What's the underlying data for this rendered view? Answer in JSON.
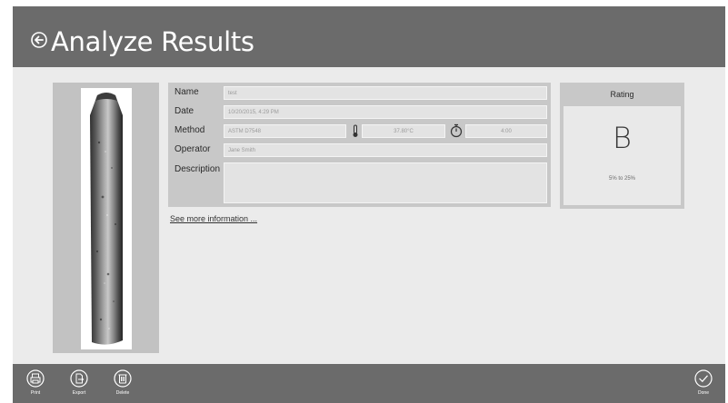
{
  "header": {
    "title": "Analyze Results",
    "back_icon": "back-arrow-circle-icon"
  },
  "image": {
    "alt": "Test specimen"
  },
  "details": {
    "name_label": "Name",
    "name_value": "test",
    "date_label": "Date",
    "date_value": "10/20/2015, 4:29 PM",
    "method_label": "Method",
    "method_value": "ASTM D7548",
    "temperature_icon": "thermometer-icon",
    "temperature_value": "37.80°C",
    "duration_icon": "stopwatch-icon",
    "duration_value": "4:00",
    "operator_label": "Operator",
    "operator_value": "Jane Smith",
    "description_label": "Description",
    "description_value": ""
  },
  "see_more": "See more information ...",
  "rating": {
    "label": "Rating",
    "grade": "B",
    "range": "5% to 25%"
  },
  "bottom_bar": {
    "print": "Print",
    "export": "Export",
    "delete": "Delete",
    "done": "Done"
  },
  "colors": {
    "bar": "#6b6b6b",
    "content_bg": "#ebebeb",
    "panel": "#c8c8c8"
  }
}
